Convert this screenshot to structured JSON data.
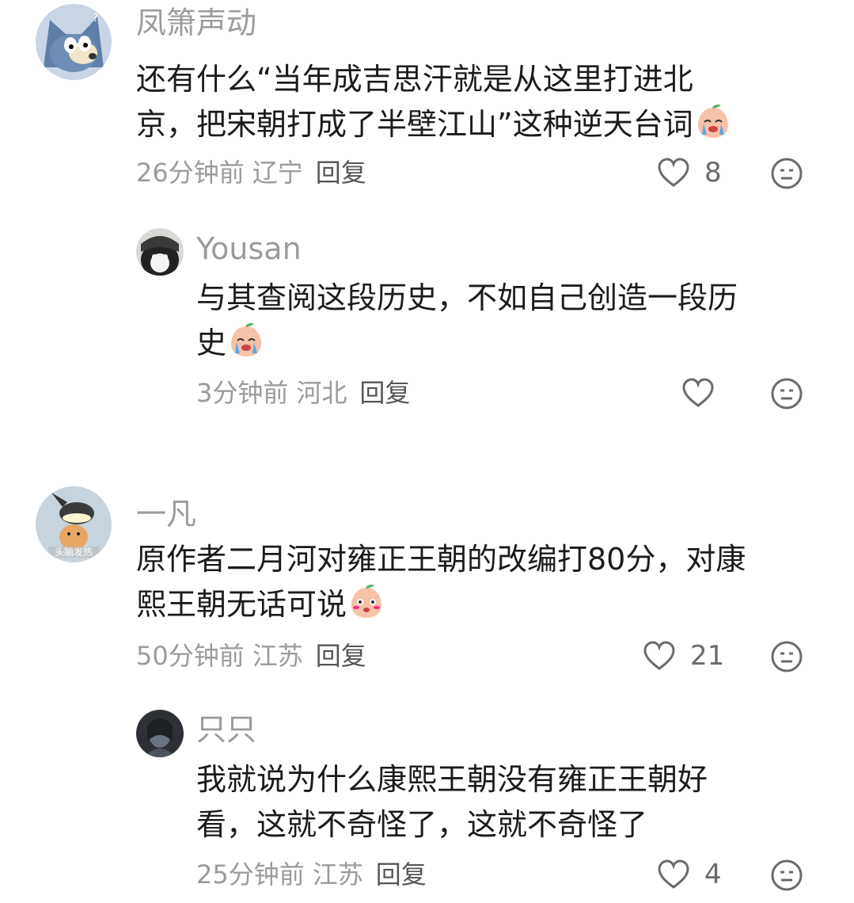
{
  "comments": [
    {
      "user": "凤箫声动",
      "text_lines": [
        "还有什么“当年成吉思汗就是从这里打进北",
        "京，把宋朝打成了半壁江山”这种逆天台词"
      ],
      "emoji": "crying-peach-emoji",
      "time": "26分钟前",
      "location": "辽宁",
      "reply": "回复",
      "likes": "8",
      "avatar": "cartoon-cat-avatar"
    },
    {
      "user": "Yousan",
      "text_lines": [
        "与其查阅这段历史，不如自己创造一段历",
        "史"
      ],
      "emoji": "crying-peach-emoji",
      "time": "3分钟前",
      "location": "河北",
      "reply": "回复",
      "likes": "",
      "avatar": "black-white-cat-avatar"
    },
    {
      "user": "一凡",
      "text_lines": [
        "原作者二月河对雍正王朝的改编打80分，对康",
        "熙王朝无话可说"
      ],
      "emoji": "shy-peach-emoji",
      "time": "50分钟前",
      "location": "江苏",
      "reply": "回复",
      "likes": "21",
      "avatar": "cat-under-lamp-avatar",
      "avatar_caption": "头脑发热"
    },
    {
      "user": "只只",
      "text_lines": [
        "我就说为什么康熙王朝没有雍正王朝好",
        "看，这就不奇怪了，这就不奇怪了"
      ],
      "time": "25分钟前",
      "location": "江苏",
      "reply": "回复",
      "likes": "4",
      "avatar": "dark-figure-avatar"
    }
  ],
  "colors": {
    "username": "#9b9b9b",
    "text": "#1b1b1b",
    "meta": "#9b9b9b",
    "icon": "#6b6b6b"
  }
}
